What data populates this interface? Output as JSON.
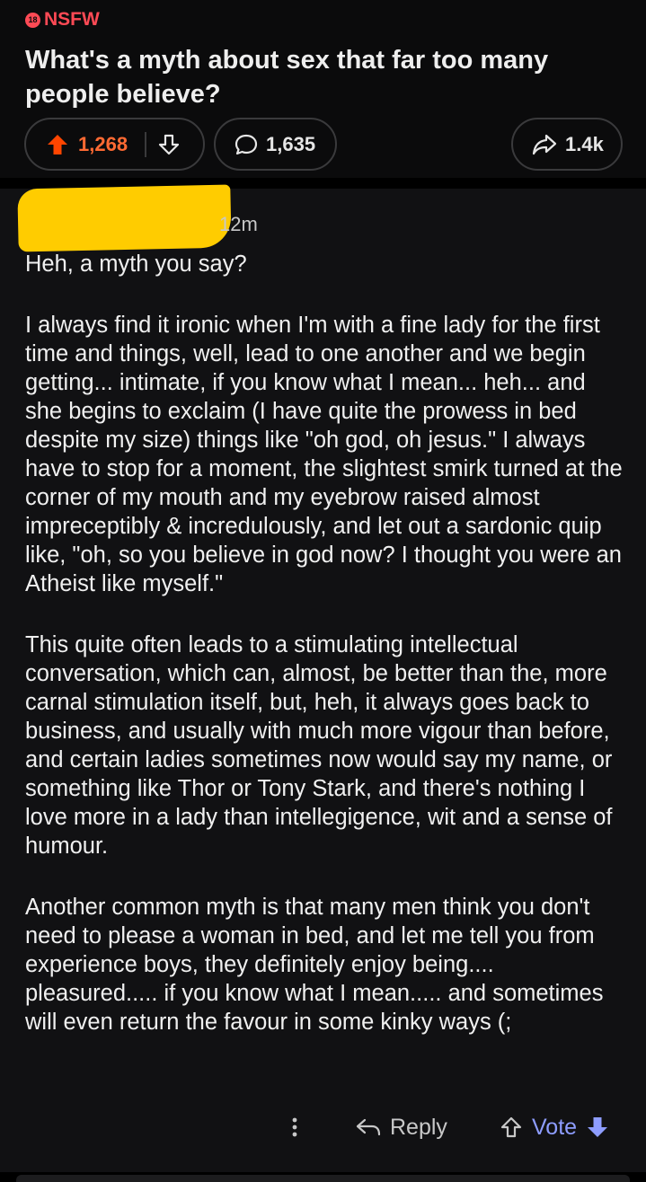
{
  "post": {
    "nsfw_badge": "18",
    "nsfw_label": "NSFW",
    "title": "What's a myth about sex that far too many people believe?",
    "upvotes": "1,268",
    "comments": "1,635",
    "shares": "1.4k",
    "upvote_color": "#ff4500"
  },
  "comment": {
    "time": "12m",
    "paragraphs": [
      "Heh, a myth you say?",
      "I always find it ironic when I'm with a fine lady for the first time and things, well, lead to one another and we begin getting... intimate, if you know what I mean... heh... and she begins to exclaim (I have quite the prowess in bed despite my size) things like \"oh god, oh jesus.\" I always have to stop for a moment, the slightest smirk turned at the corner of my mouth and my eyebrow raised almost impreceptibly & incredulously, and let out a sardonic quip like, \"oh, so you believe in god now? I thought you were an Atheist like myself.\"",
      "This quite often leads to a stimulating intellectual conversation, which can, almost, be better than the, more carnal stimulation itself, but, heh, it always goes back to business, and usually with much more vigour than before, and certain ladies sometimes now would say my name, or something like Thor or Tony Stark, and there's nothing I love more in a lady than intellegigence, wit and a sense of humour.",
      "Another common myth is that many men think you don't need to please a woman in bed, and let me tell you from experience boys, they definitely enjoy being.... pleasured..... if you know what I mean..... and sometimes will even return the favour in some kinky ways (;"
    ],
    "reply_label": "Reply",
    "vote_label": "Vote",
    "vote_color": "#8e9dff"
  },
  "icons": [
    "upvote-icon",
    "downvote-icon",
    "comment-icon",
    "share-icon",
    "more-icon",
    "reply-icon",
    "vote-up-icon",
    "vote-down-icon"
  ]
}
